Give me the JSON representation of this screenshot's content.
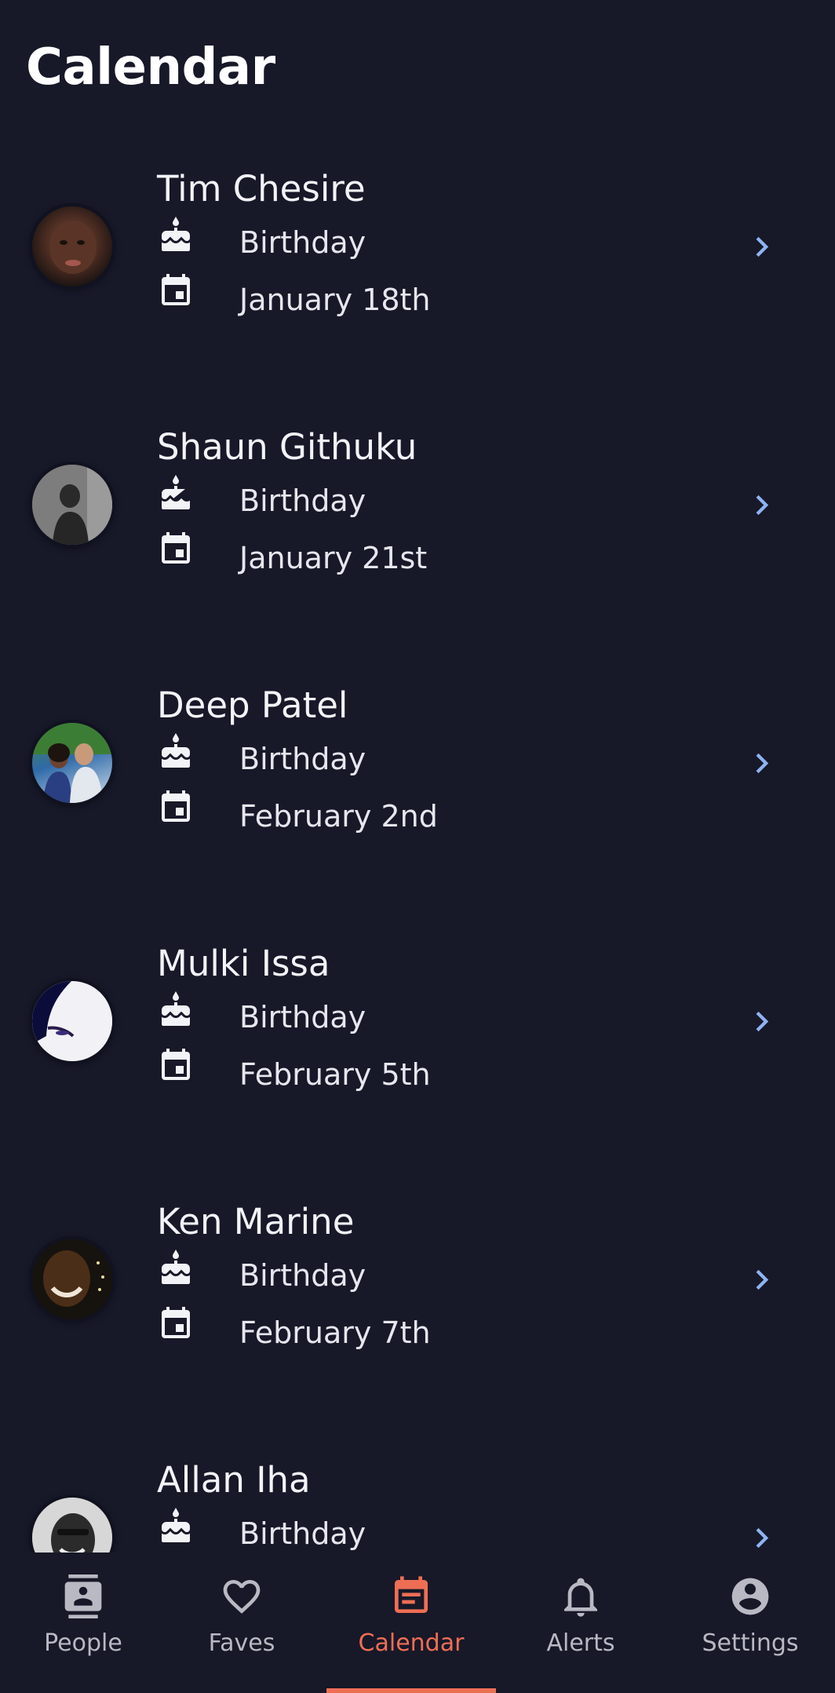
{
  "header": {
    "title": "Calendar"
  },
  "events": [
    {
      "name": "Tim Chesire",
      "event_type": "Birthday",
      "date": "January 18th"
    },
    {
      "name": "Shaun Githuku",
      "event_type": "Birthday",
      "date": "January 21st"
    },
    {
      "name": "Deep Patel",
      "event_type": "Birthday",
      "date": "February 2nd"
    },
    {
      "name": "Mulki Issa",
      "event_type": "Birthday",
      "date": "February 5th"
    },
    {
      "name": "Ken Marine",
      "event_type": "Birthday",
      "date": "February 7th"
    },
    {
      "name": "Allan Iha",
      "event_type": "Birthday",
      "date": ""
    }
  ],
  "icons": {
    "event_type": "cake-icon",
    "date": "calendar-event-icon",
    "open": "chevron-right-icon"
  },
  "bottom_nav": {
    "active": "Calendar",
    "items": [
      {
        "label": "People",
        "icon": "contacts-icon"
      },
      {
        "label": "Faves",
        "icon": "heart-icon"
      },
      {
        "label": "Calendar",
        "icon": "calendar-text-icon"
      },
      {
        "label": "Alerts",
        "icon": "bell-icon"
      },
      {
        "label": "Settings",
        "icon": "account-circle-icon"
      }
    ]
  },
  "colors": {
    "background": "#171828",
    "accent": "#ee6e54",
    "chevron": "#8fb3f2",
    "text": "#e9eaf0",
    "nav_inactive": "#b8b9c2"
  }
}
